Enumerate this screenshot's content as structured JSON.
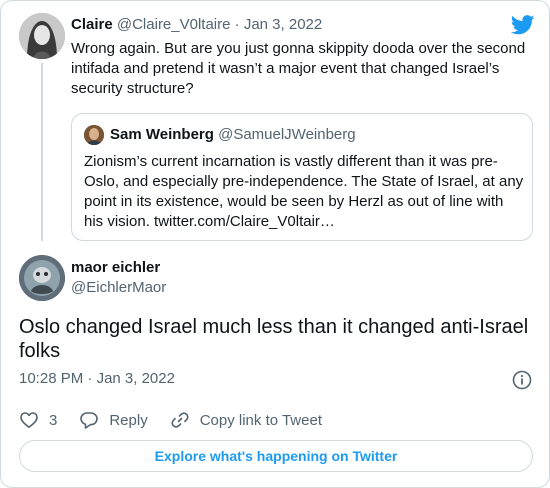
{
  "parent_tweet": {
    "author_name": "Claire",
    "author_handle": "@Claire_V0ltaire",
    "separator": "·",
    "date": "Jan 3, 2022",
    "text": "Wrong again. But are you just gonna skippity dooda over the second intifada and pretend it wasn’t a major event that changed Israel’s security structure?"
  },
  "quoted_tweet": {
    "author_name": "Sam Weinberg",
    "author_handle": "@SamuelJWeinberg",
    "text": "Zionism’s current incarnation is vastly different than it was pre-Oslo, and especially pre-independence. The State of Israel, at any point in its existence, would be seen by Herzl as out of line with his vision. twitter.com/Claire_V0ltair…"
  },
  "main_tweet": {
    "author_name": "maor eichler",
    "author_handle": "@EichlerMaor",
    "text": "Oslo changed Israel much less than it changed anti-Israel folks",
    "time": "10:28 PM",
    "separator": "·",
    "date": "Jan 3, 2022"
  },
  "actions": {
    "like_count": "3",
    "reply_label": "Reply",
    "copy_link_label": "Copy link to Tweet"
  },
  "explore_button": {
    "label": "Explore what's happening on Twitter"
  },
  "icons": {
    "brand": "twitter-bird-icon",
    "like": "heart-icon",
    "reply": "speech-bubble-icon",
    "copy": "link-icon",
    "info": "info-icon"
  },
  "colors": {
    "accent": "#1d9bf0",
    "text": "#0f1419",
    "muted": "#536471",
    "border": "#cfd9de"
  }
}
